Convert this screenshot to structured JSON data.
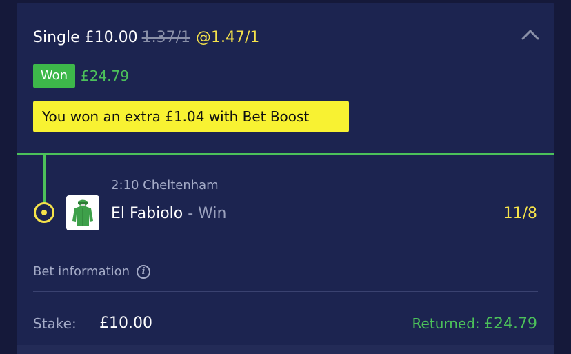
{
  "bet": {
    "type_stake": "Single £10.00",
    "old_odds": "1.37/1",
    "boosted_odds": "@1.47/1"
  },
  "result": {
    "badge": "Won",
    "amount": "£24.79",
    "boost_message": "You won an extra £1.04 with Bet Boost"
  },
  "selection": {
    "race": "2:10 Cheltenham",
    "horse": "El Fabiolo",
    "market": " - Win",
    "odds": "11/8"
  },
  "bet_information": {
    "label": "Bet information",
    "icon": "info-icon"
  },
  "footer": {
    "stake_label": "Stake:",
    "stake_value": "£10.00",
    "returned_label": "Returned: ",
    "returned_value": "£24.79"
  },
  "colors": {
    "background": "#15193a",
    "card": "#1c2450",
    "win_green": "#3db84a",
    "odds_yellow": "#f5e24a",
    "boost_yellow": "#f8f232",
    "muted_text": "#a4abc7"
  },
  "icons": {
    "collapse": "chevron-up-icon",
    "leg_marker": "selection-marker-icon",
    "silks": "jockey-silks-icon"
  }
}
